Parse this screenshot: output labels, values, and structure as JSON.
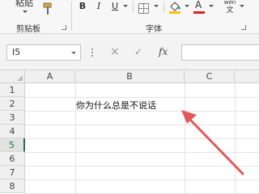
{
  "ribbon": {
    "clipboard": {
      "paste_label": "粘贴",
      "group_label": "剪贴板"
    },
    "font": {
      "bold": "B",
      "italic": "I",
      "underline": "U",
      "phonetic_top": "wén",
      "phonetic_bottom": "文",
      "group_label": "字体",
      "fill_color": "#f5c400",
      "font_color": "#e02020"
    }
  },
  "formula_bar": {
    "name_box": "I5",
    "cancel_icon": "×",
    "enter_icon": "✓",
    "fx_label": "fx",
    "formula_value": ""
  },
  "sheet": {
    "columns": [
      "A",
      "B",
      "C"
    ],
    "rows": [
      "1",
      "2",
      "3",
      "4",
      "5",
      "6",
      "7",
      "8"
    ],
    "active_row": "5",
    "cells": {
      "B2": "你为什么总是不说话"
    }
  },
  "annotation": {
    "arrow_color": "#e05a5a"
  }
}
